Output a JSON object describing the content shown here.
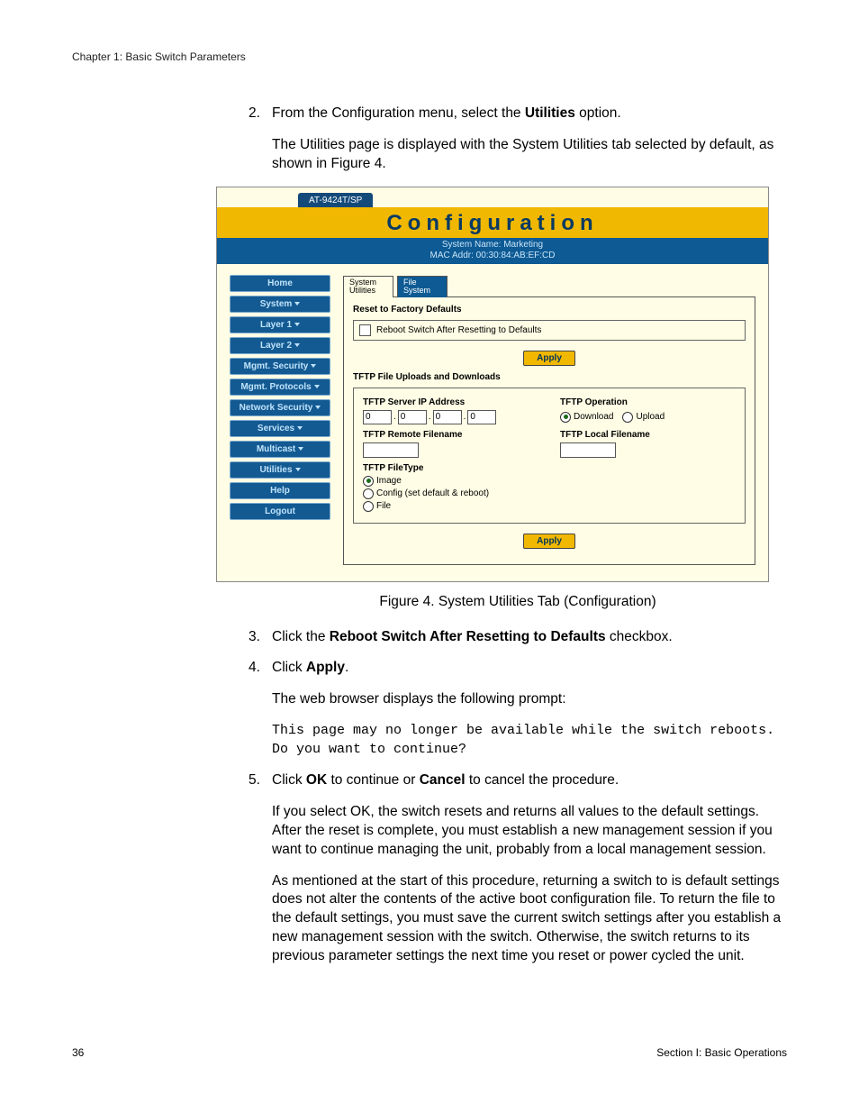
{
  "header": {
    "chapter": "Chapter 1: Basic Switch Parameters"
  },
  "steps": {
    "s2": {
      "num": "2.",
      "pre": "From the Configuration menu, select the ",
      "bold": "Utilities",
      "post": " option.",
      "para": "The Utilities page is displayed with the System Utilities tab selected by default, as shown in Figure 4."
    },
    "caption": "Figure 4. System Utilities Tab (Configuration)",
    "s3": {
      "num": "3.",
      "pre": "Click the ",
      "bold": "Reboot Switch After Resetting to Defaults",
      "post": " checkbox."
    },
    "s4": {
      "num": "4.",
      "pre": "Click ",
      "bold": "Apply",
      "post": ".",
      "para": "The web browser displays the following prompt:",
      "code": "This page may no longer be available while the switch reboots. Do you want to continue?"
    },
    "s5": {
      "num": "5.",
      "pre": "Click ",
      "b1": "OK",
      "mid": " to continue or ",
      "b2": "Cancel",
      "post": " to cancel the procedure.",
      "para1": "If you select OK, the switch resets and returns all values to the default settings. After the reset is complete, you must establish a new management session if you want to continue managing the unit, probably from a local management session.",
      "para2": "As mentioned at the start of this procedure, returning a switch to is default settings does not alter the contents of the active boot configuration file. To return the file to the default settings, you must save the current switch settings after you establish a new management session with the switch. Otherwise, the switch returns to its previous parameter settings the next time you reset or power cycled the unit."
    }
  },
  "ui": {
    "tab": "AT-9424T/SP",
    "title": "Configuration",
    "sys1": "System Name: Marketing",
    "sys2": "MAC Addr: 00:30:84:AB:EF:CD",
    "sidebar": [
      "Home",
      "System",
      "Layer 1",
      "Layer 2",
      "Mgmt. Security",
      "Mgmt. Protocols",
      "Network Security",
      "Services",
      "Multicast",
      "Utilities",
      "Help",
      "Logout"
    ],
    "subtab1a": "System",
    "subtab1b": "Utilities",
    "subtab2a": "File",
    "subtab2b": "System",
    "reset_title": "Reset to Factory Defaults",
    "reset_check": "Reboot Switch After Resetting to Defaults",
    "apply": "Apply",
    "tftp_title": "TFTP File Uploads and Downloads",
    "tftp_ip_label": "TFTP Server IP Address",
    "ip": [
      "0",
      "0",
      "0",
      "0"
    ],
    "tftp_remote": "TFTP Remote Filename",
    "tftp_ft": "TFTP FileType",
    "ft_image": "Image",
    "ft_config": "Config (set default & reboot)",
    "ft_file": "File",
    "tftp_op": "TFTP Operation",
    "op_down": "Download",
    "op_up": "Upload",
    "tftp_local": "TFTP Local Filename"
  },
  "footer": {
    "page": "36",
    "section": "Section I: Basic Operations"
  }
}
